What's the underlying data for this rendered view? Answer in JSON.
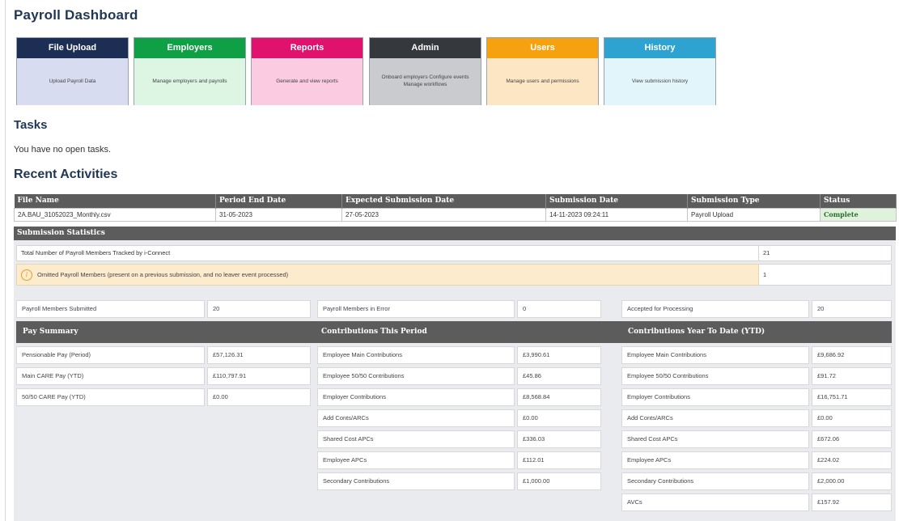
{
  "page": {
    "title": "Payroll Dashboard"
  },
  "tiles": [
    {
      "title": "File Upload",
      "desc": "Upload Payroll Data",
      "head_color": "#1d2e55",
      "body_color": "#d7dcf1"
    },
    {
      "title": "Employers",
      "desc": "Manage employers and payrolls",
      "head_color": "#0f9f44",
      "body_color": "#dcf6e3"
    },
    {
      "title": "Reports",
      "desc": "Generate and view reports",
      "head_color": "#e0126e",
      "body_color": "#fbcbe1"
    },
    {
      "title": "Admin",
      "desc": "Onboard employers Configure events Manage workflows",
      "head_color": "#35383d",
      "body_color": "#c9cbce"
    },
    {
      "title": "Users",
      "desc": "Manage users and permissions",
      "head_color": "#f6a10f",
      "body_color": "#fde6c4"
    },
    {
      "title": "History",
      "desc": "View submission history",
      "head_color": "#2ea3d2",
      "body_color": "#e2f5fb"
    }
  ],
  "tasks": {
    "title": "Tasks",
    "empty_message": "You have no open tasks."
  },
  "recent": {
    "title": "Recent Activities",
    "columns": [
      "File Name",
      "Period End Date",
      "Expected Submission Date",
      "Submission Date",
      "Submission Type",
      "Status"
    ],
    "rows": [
      {
        "file_name": "2A.BAU_31052023_Monthly.csv",
        "period_end_date": "31-05-2023",
        "expected_submission_date": "27-05-2023",
        "submission_date": "14-11-2023 09:24:11",
        "submission_type": "Payroll Upload",
        "status": "Complete"
      }
    ]
  },
  "stats": {
    "title": "Submission Statistics",
    "tracked_label": "Total Number of Payroll Members Tracked by i-Connect",
    "tracked_value": "21",
    "omitted_label": "Omitted Payroll Members (present on a previous submission, and no leaver event processed)",
    "omitted_value": "1",
    "submitted_label": "Payroll Members Submitted",
    "submitted_value": "20",
    "error_label": "Payroll Members in Error",
    "error_value": "0",
    "accepted_label": "Accepted for Processing",
    "accepted_value": "20",
    "pay_summary": {
      "title": "Pay Summary",
      "rows": [
        {
          "label": "Pensionable Pay (Period)",
          "value": "£57,126.31"
        },
        {
          "label": "Main CARE Pay (YTD)",
          "value": "£110,797.91"
        },
        {
          "label": "50/50 CARE Pay (YTD)",
          "value": "£0.00"
        }
      ]
    },
    "contrib_period": {
      "title": "Contributions This Period",
      "rows": [
        {
          "label": "Employee Main Contributions",
          "value": "£3,990.61"
        },
        {
          "label": "Employee 50/50 Contributions",
          "value": "£45.86"
        },
        {
          "label": "Employer Contributions",
          "value": "£8,568.84"
        },
        {
          "label": "Add Conts/ARCs",
          "value": "£0.00"
        },
        {
          "label": "Shared Cost APCs",
          "value": "£336.03"
        },
        {
          "label": "Employee APCs",
          "value": "£112.01"
        },
        {
          "label": "Secondary Contributions",
          "value": "£1,000.00"
        }
      ]
    },
    "contrib_ytd": {
      "title": "Contributions Year To Date (YTD)",
      "rows": [
        {
          "label": "Employee Main Contributions",
          "value": "£9,686.92"
        },
        {
          "label": "Employee 50/50 Contributions",
          "value": "£91.72"
        },
        {
          "label": "Employer Contributions",
          "value": "£16,751.71"
        },
        {
          "label": "Add Conts/ARCs",
          "value": "£0.00"
        },
        {
          "label": "Shared Cost APCs",
          "value": "£672.06"
        },
        {
          "label": "Employee APCs",
          "value": "£224.02"
        },
        {
          "label": "Secondary Contributions",
          "value": "£2,000.00"
        },
        {
          "label": "AVCs",
          "value": "£157.92"
        }
      ]
    }
  }
}
